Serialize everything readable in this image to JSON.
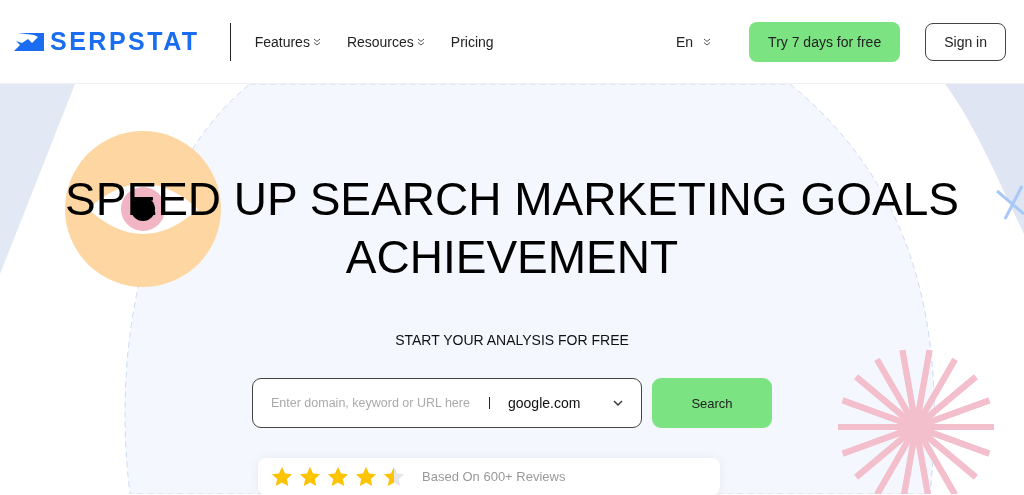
{
  "header": {
    "logo": "SERPSTAT",
    "nav": [
      {
        "label": "Features",
        "dropdown": true
      },
      {
        "label": "Resources",
        "dropdown": true
      },
      {
        "label": "Pricing",
        "dropdown": false
      }
    ],
    "language": "En",
    "trial_button": "Try 7 days for free",
    "signin_button": "Sign in"
  },
  "hero": {
    "title_lines": [
      "SPEED UP SEARCH MARKETING GOALS",
      "ACHIEVEMENT"
    ],
    "subtitle": "START YOUR ANALYSIS FOR FREE",
    "search": {
      "placeholder": "Enter domain, keyword or URL here",
      "engine": "google.com",
      "button": "Search"
    },
    "reviews": {
      "stars": 4.5,
      "text": "Based On 600+ Reviews"
    }
  }
}
